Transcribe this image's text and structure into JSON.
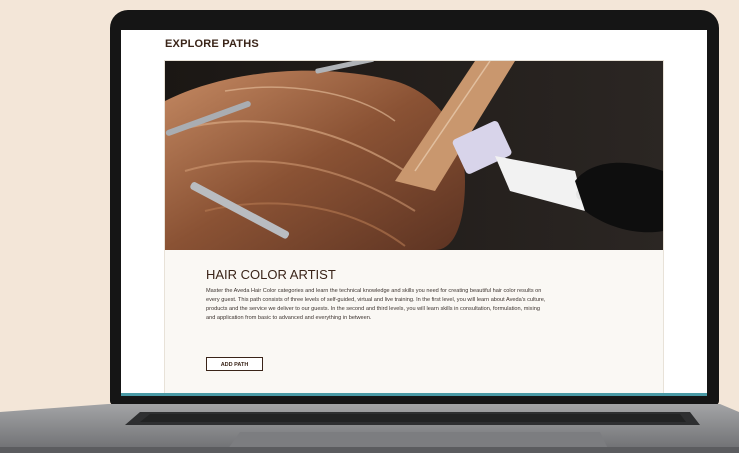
{
  "page": {
    "section_title": "EXPLORE PATHS"
  },
  "path_card": {
    "title": "HAIR COLOR ARTIST",
    "description": "Master the Aveda Hair Color categories and learn the technical knowledge and skills you need for creating beautiful hair color results on every guest. This path consists of three levels of self-guided, virtual and live training. In the first level, you will learn about Aveda's culture, products and the service we deliver to our guests. In the second and third levels, you will learn skills in consultation, formulation, mixing and application from basic to advanced and everything in between.",
    "add_label": "ADD PATH"
  },
  "colors": {
    "background": "#f3e6d8",
    "accent": "#3a2418",
    "strip": "#4a9aa6"
  }
}
